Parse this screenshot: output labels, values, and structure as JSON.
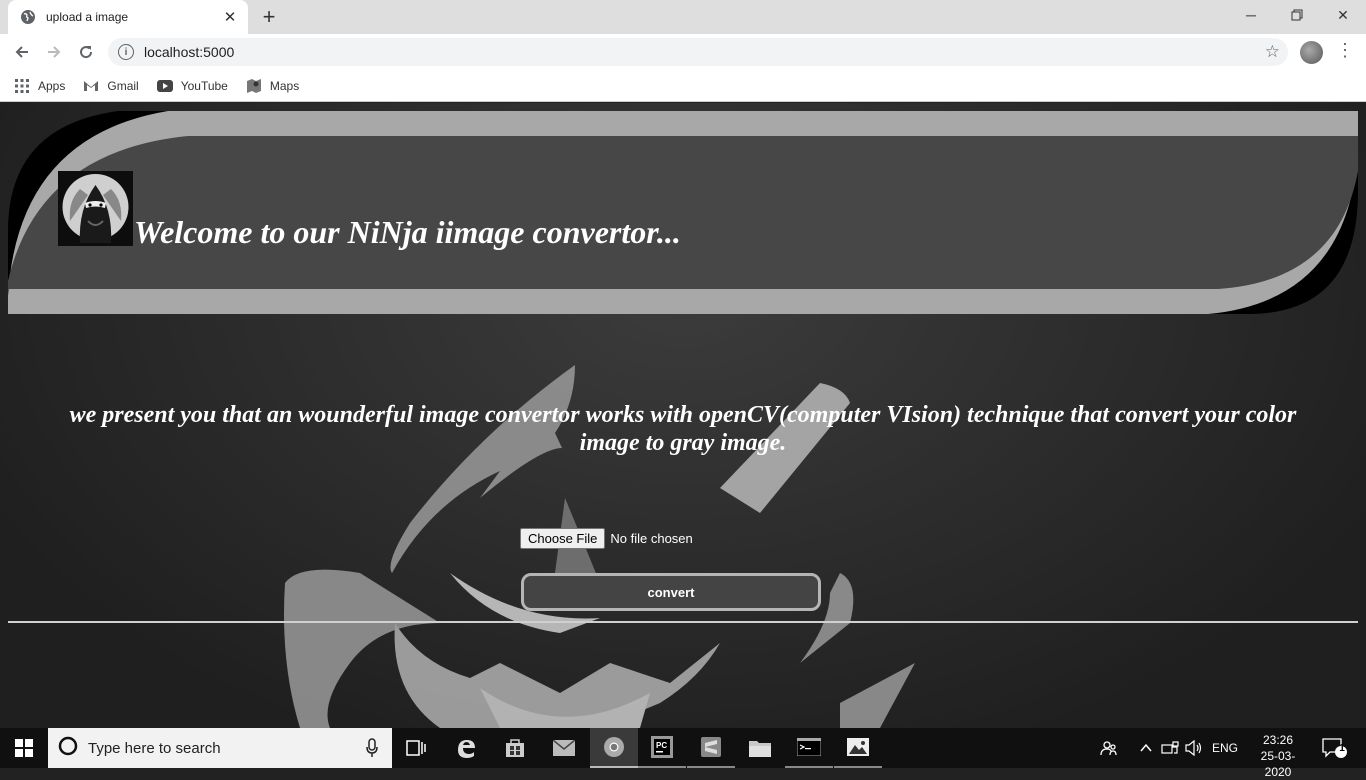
{
  "browser": {
    "tab_title": "upload a image",
    "url": "localhost:5000",
    "bookmarks": [
      {
        "label": "Apps",
        "icon": "apps-grid-icon"
      },
      {
        "label": "Gmail",
        "icon": "gmail-icon"
      },
      {
        "label": "YouTube",
        "icon": "youtube-icon"
      },
      {
        "label": "Maps",
        "icon": "maps-icon"
      }
    ]
  },
  "page": {
    "welcome": "Welcome to our NiNja iimage convertor...",
    "intro": "we present you that an wounderful image convertor works with openCV(computer VIsion) technique that convert your color image to gray image.",
    "choose_file": "Choose File",
    "no_file": "No file chosen",
    "convert": "convert"
  },
  "taskbar": {
    "search_placeholder": "Type here to search",
    "language": "ENG",
    "time": "23:26",
    "date": "25-03-2020",
    "notification_count": "1"
  }
}
